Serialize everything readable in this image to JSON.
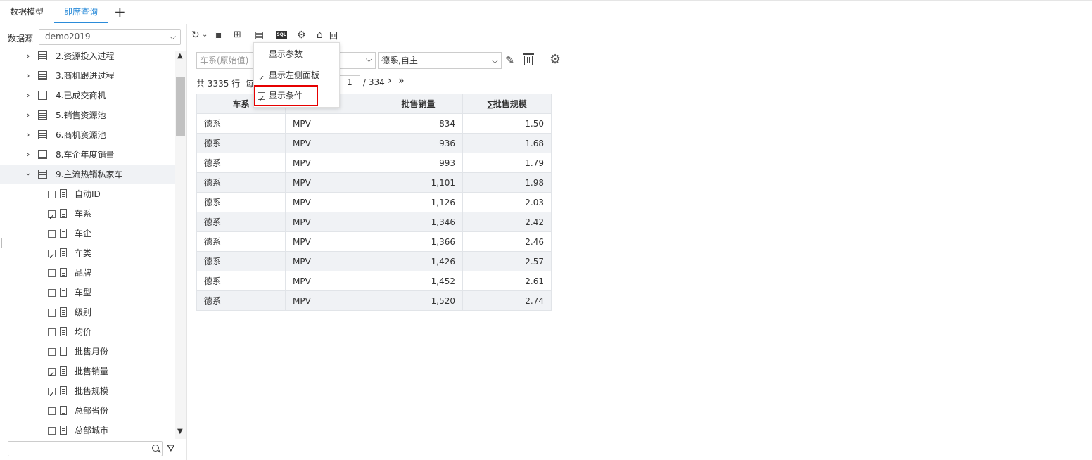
{
  "tabs": [
    {
      "label": "数据模型"
    },
    {
      "label": "即席查询"
    }
  ],
  "add_tab": "+",
  "left": {
    "ds_label": "数据源",
    "ds_value": "demo2019",
    "tables": [
      {
        "label": "2.资源投入过程"
      },
      {
        "label": "3.商机跟进过程"
      },
      {
        "label": "4.已成交商机"
      },
      {
        "label": "5.销售资源池"
      },
      {
        "label": "6.商机资源池"
      },
      {
        "label": "8.车企年度销量"
      },
      {
        "label": "9.主流热销私家车"
      }
    ],
    "fields": [
      {
        "label": "自动ID",
        "checked": false
      },
      {
        "label": "车系",
        "checked": true
      },
      {
        "label": "车企",
        "checked": false
      },
      {
        "label": "车类",
        "checked": true
      },
      {
        "label": "品牌",
        "checked": false
      },
      {
        "label": "车型",
        "checked": false
      },
      {
        "label": "级别",
        "checked": false
      },
      {
        "label": "均价",
        "checked": false
      },
      {
        "label": "批售月份",
        "checked": false
      },
      {
        "label": "批售销量",
        "checked": true
      },
      {
        "label": "批售规模",
        "checked": true
      },
      {
        "label": "总部省份",
        "checked": false
      },
      {
        "label": "总部城市",
        "checked": false
      }
    ],
    "search_placeholder": ""
  },
  "toolbar": {
    "sql": "SQL",
    "back_label": "回到模型"
  },
  "condition": {
    "field_placeholder": "车系(原始值)",
    "value": "德系,自主"
  },
  "pager": {
    "total": "共 3335 行",
    "per": "每",
    "page": "1",
    "of": "/ 334"
  },
  "menu": [
    {
      "label": "显示参数",
      "checked": false
    },
    {
      "label": "显示左侧面板",
      "checked": true
    },
    {
      "label": "显示条件",
      "checked": true
    }
  ],
  "table": {
    "headers": [
      "车系",
      "车类",
      "批售销量",
      "∑批售规模"
    ],
    "rows": [
      [
        "德系",
        "MPV",
        "834",
        "1.50"
      ],
      [
        "德系",
        "MPV",
        "936",
        "1.68"
      ],
      [
        "德系",
        "MPV",
        "993",
        "1.79"
      ],
      [
        "德系",
        "MPV",
        "1,101",
        "1.98"
      ],
      [
        "德系",
        "MPV",
        "1,126",
        "2.03"
      ],
      [
        "德系",
        "MPV",
        "1,346",
        "2.42"
      ],
      [
        "德系",
        "MPV",
        "1,366",
        "2.46"
      ],
      [
        "德系",
        "MPV",
        "1,426",
        "2.57"
      ],
      [
        "德系",
        "MPV",
        "1,452",
        "2.61"
      ],
      [
        "德系",
        "MPV",
        "1,520",
        "2.74"
      ]
    ]
  },
  "colors": {
    "accent": "#2a8bd9",
    "highlight": "#e60000",
    "row_alt": "#f0f2f5"
  }
}
